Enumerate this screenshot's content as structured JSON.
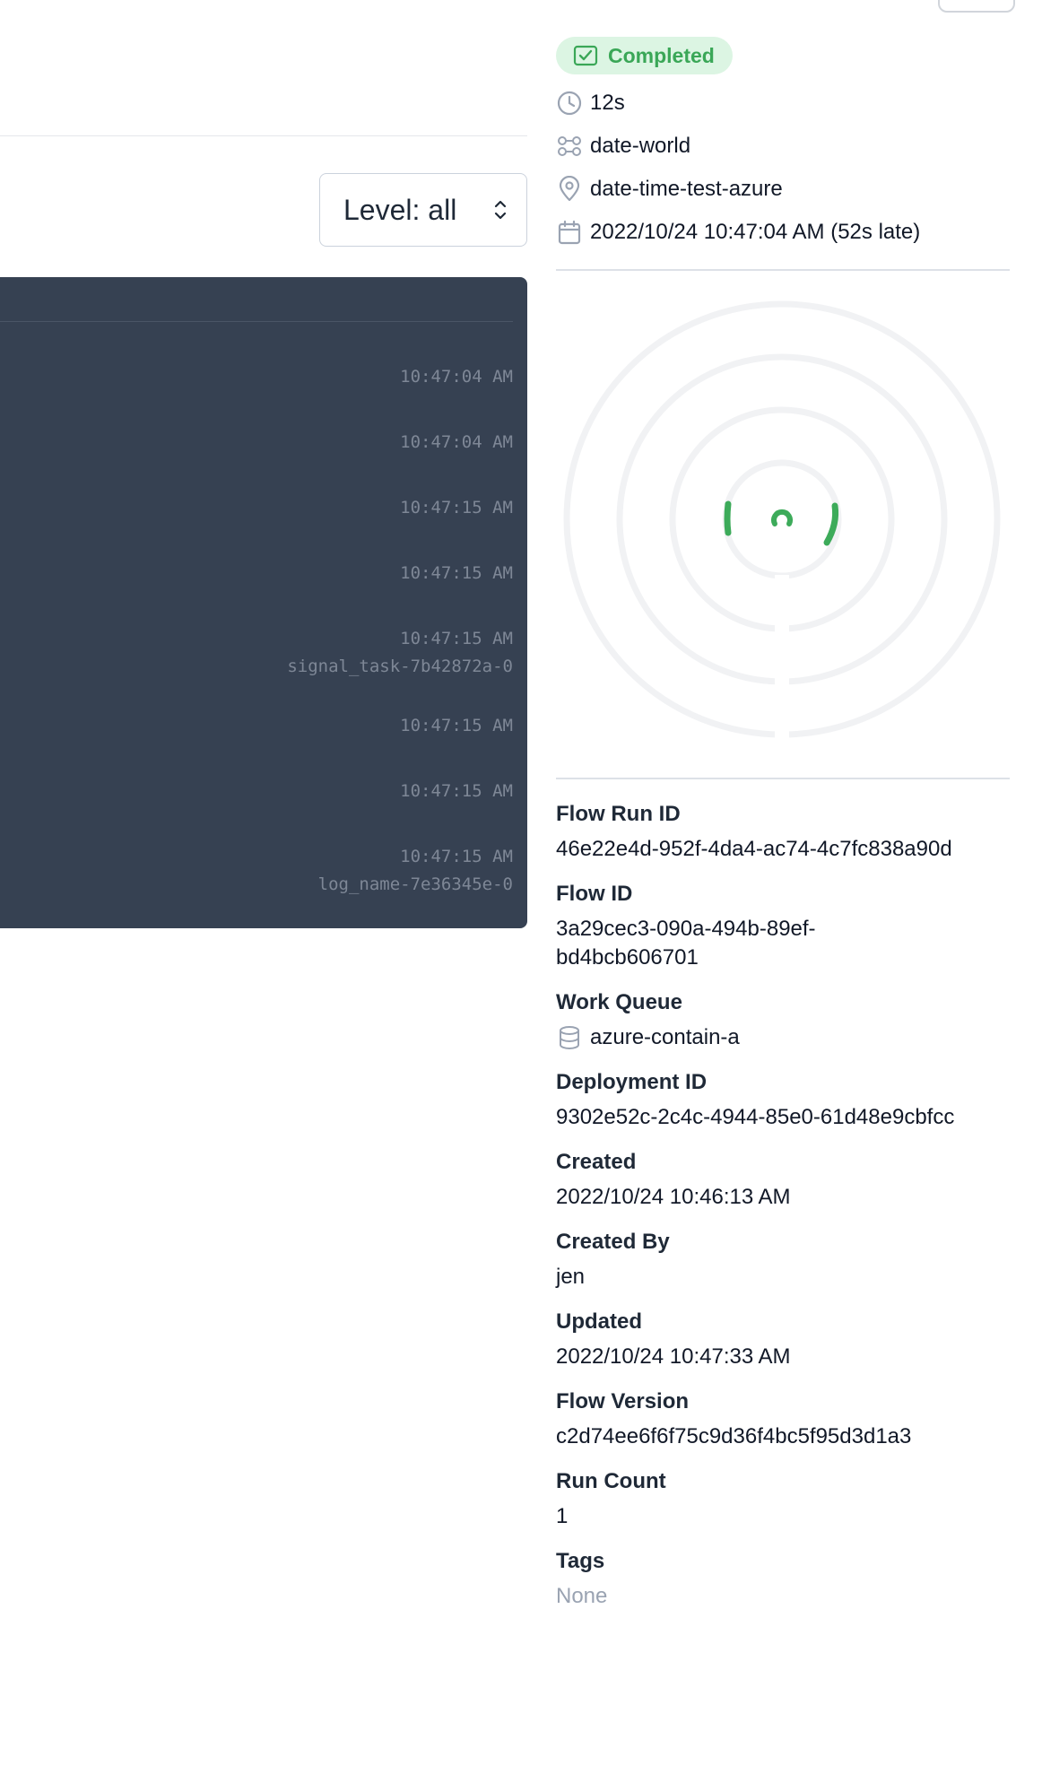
{
  "filter": {
    "level_label": "Level: all"
  },
  "logs": [
    {
      "time": "10:47:04 AM",
      "task": ""
    },
    {
      "time": "10:47:04 AM",
      "task": ""
    },
    {
      "time": "10:47:15 AM",
      "task": ""
    },
    {
      "time": "10:47:15 AM",
      "task": ""
    },
    {
      "time": "10:47:15 AM",
      "task": "signal_task-7b42872a-0"
    },
    {
      "time": "10:47:15 AM",
      "task": ""
    },
    {
      "time": "10:47:15 AM",
      "task": ""
    },
    {
      "time": "10:47:15 AM",
      "task": "log_name-7e36345e-0"
    }
  ],
  "summary": {
    "state": "Completed",
    "duration": "12s",
    "flow": "date-world",
    "deployment": "date-time-test-azure",
    "scheduled": "2022/10/24 10:47:04 AM (52s late)"
  },
  "details": {
    "flow_run_id_label": "Flow Run ID",
    "flow_run_id": "46e22e4d-952f-4da4-ac74-4c7fc838a90d",
    "flow_id_label": "Flow ID",
    "flow_id_line1": "3a29cec3-090a-494b-89ef-",
    "flow_id_line2": "bd4bcb606701",
    "work_queue_label": "Work Queue",
    "work_queue": "azure-contain-a",
    "deployment_id_label": "Deployment ID",
    "deployment_id": "9302e52c-2c4c-4944-85e0-61d48e9cbfcc",
    "created_label": "Created",
    "created": "2022/10/24 10:46:13 AM",
    "created_by_label": "Created By",
    "created_by": "jen",
    "updated_label": "Updated",
    "updated": "2022/10/24 10:47:33 AM",
    "flow_version_label": "Flow Version",
    "flow_version": "c2d74ee6f6f75c9d36f4bc5f95d3d1a3",
    "run_count_label": "Run Count",
    "run_count": "1",
    "tags_label": "Tags",
    "tags": "None"
  },
  "colors": {
    "success": "#3aa757",
    "log_bg": "#364152",
    "icon_gray": "#9aa3b2"
  },
  "icons": {
    "state": "check-square-icon",
    "duration": "clock-icon",
    "flow": "flow-icon",
    "deployment": "map-pin-icon",
    "scheduled": "calendar-icon",
    "work_queue": "database-icon",
    "select": "chevron-up-down-icon"
  }
}
